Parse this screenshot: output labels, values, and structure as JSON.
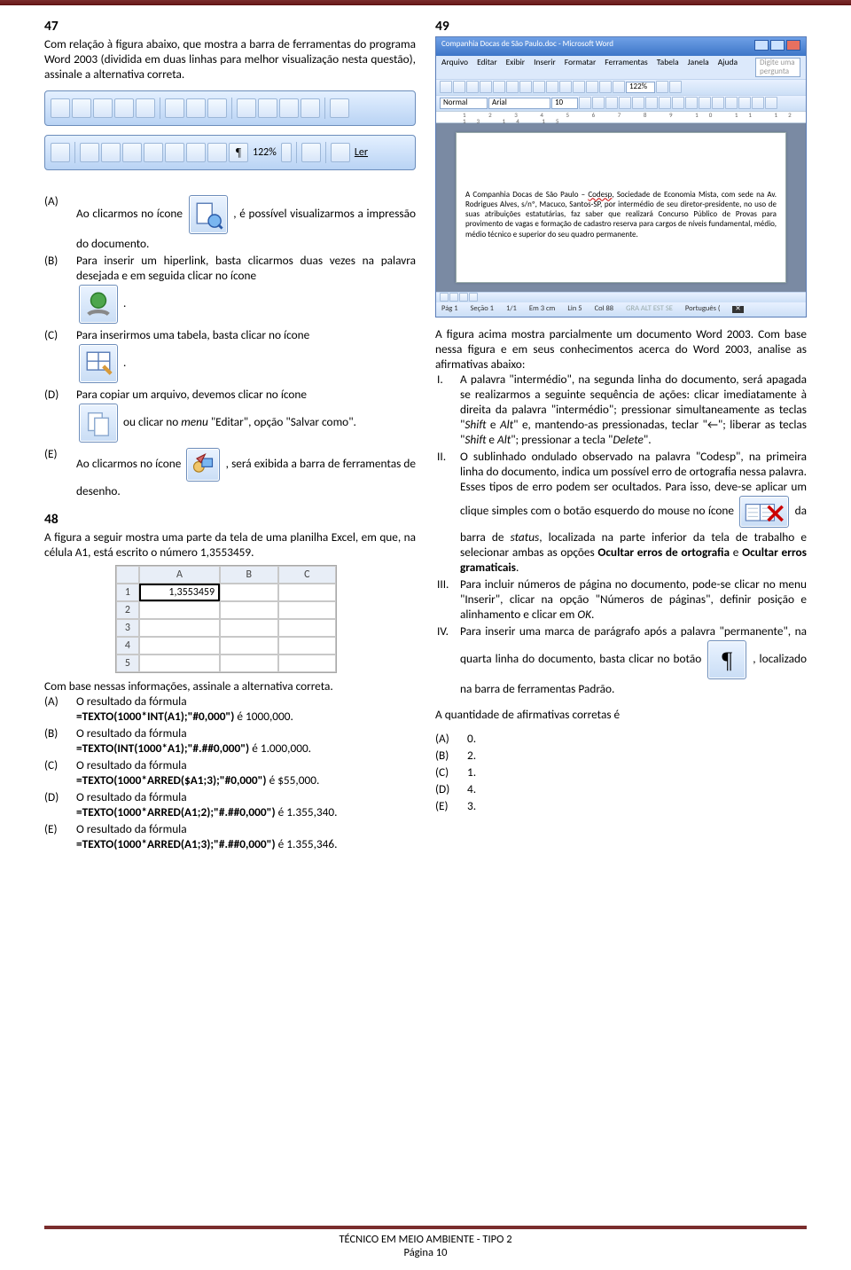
{
  "q47": {
    "number": "47",
    "stem": "Com relação à figura abaixo, que mostra a barra de ferramentas do programa Word 2003 (dividida em duas linhas para melhor visualização nesta questão), assinale a alternativa correta.",
    "toolbar2_zoom": "122%",
    "toolbar2_ler": "Ler",
    "options": {
      "A": {
        "pre": "Ao clicarmos no ícone ",
        "post": ", é possível visualizarmos a impressão do documento."
      },
      "B": {
        "pre": "Para inserir um hiperlink, basta clicarmos duas vezes na palavra desejada e em seguida clicar no ícone ",
        "post": "."
      },
      "C": {
        "pre": "Para inserirmos uma tabela, basta clicar no ícone ",
        "post": "."
      },
      "D": {
        "pre": "Para copiar um arquivo, devemos clicar no ícone ",
        "mid": " ou clicar no ",
        "menu": "menu",
        "mid2": " \"Editar\", opção \"Salvar como\"."
      },
      "E": {
        "pre": "Ao clicarmos no ícone ",
        "post": ", será exibida a barra de ferramentas de desenho."
      }
    }
  },
  "q48": {
    "number": "48",
    "stem": "A figura a seguir mostra uma parte da tela de uma planilha Excel, em que, na célula A1, está escrito o número 1,3553459.",
    "excel": {
      "headers": [
        "",
        "A",
        "B",
        "C"
      ],
      "a1": "1,3553459",
      "rows": [
        "1",
        "2",
        "3",
        "4",
        "5"
      ]
    },
    "lead": "Com base nessas informações, assinale a alternativa correta.",
    "options": {
      "A": {
        "t1": "O resultado da fórmula",
        "f": "=TEXTO(1000*INT(A1);\"#0,000\")",
        "r": " é 1000,000."
      },
      "B": {
        "t1": "O resultado da fórmula",
        "f": "=TEXTO(INT(1000*A1);\"#.##0,000\")",
        "r": " é 1.000,000."
      },
      "C": {
        "t1": "O resultado da fórmula",
        "f": "=TEXTO(1000*ARRED($A1;3);\"#0,000\")",
        "r": " é $55,000."
      },
      "D": {
        "t1": "O resultado da fórmula",
        "f": "=TEXTO(1000*ARRED(A1;2);\"#.##0,000\")",
        "r": " é 1.355,340."
      },
      "E": {
        "t1": "O resultado da fórmula",
        "f": "=TEXTO(1000*ARRED(A1;3);\"#.##0,000\")",
        "r": " é 1.355,346."
      }
    }
  },
  "q49": {
    "number": "49",
    "word": {
      "title": "Companhia Docas de São Paulo.doc - Microsoft Word",
      "menu": [
        "Arquivo",
        "Editar",
        "Exibir",
        "Inserir",
        "Formatar",
        "Ferramentas",
        "Tabela",
        "Janela",
        "Ajuda"
      ],
      "help": "Digite uma pergunta",
      "style": "Normal",
      "font": "Arial",
      "size": "10",
      "zoom": "122%",
      "ruler": "1 2 3 4 5 6 7 8 9 10 11 12 13 14 15",
      "doc": "A Companhia Docas de São Paulo – Codesp, Sociedade de Economia Mista, com sede na Av. Rodrigues Alves, s/nº, Macuco, Santos-SP, por intermédio de seu diretor-presidente, no uso de suas atribuições estatutárias, faz saber que realizará Concurso Público de Provas para provimento de vagas e formação de cadastro reserva para cargos de níveis fundamental, médio, médio técnico e superior do seu quadro permanente.",
      "codesp": "Codesp",
      "status": {
        "pag": "Pág 1",
        "sec": "Seção 1",
        "pp": "1/1",
        "em": "Em 3 cm",
        "lin": "Lin 5",
        "col": "Col 88",
        "mode": "GRA ALT EST SE",
        "lang": "Português ("
      }
    },
    "intro": "A figura acima mostra parcialmente um documento Word 2003. Com base nessa figura e em seus conhecimentos acerca do Word 2003, analise as afirmativas abaixo:",
    "I_a": "A palavra \"intermédio\", na segunda linha do documento, será apagada se realizarmos a seguinte sequência de ações: clicar imediatamente à direita da palavra \"intermédio\"; pressionar simultaneamente as teclas \"",
    "I_shift": "Shift",
    "I_b": " e ",
    "I_alt": "Alt",
    "I_c": "\" e, mantendo-as pressionadas, teclar \"←\"; liberar as teclas \"",
    "I_shift2": "Shift",
    "I_d": " e ",
    "I_alt2": "Alt",
    "I_e": "\"; pressionar a tecla \"",
    "I_del": "Delete",
    "I_f": "\".",
    "II_a": "O sublinhado ondulado observado na palavra \"Codesp\", na primeira linha do documento, indica um possível erro de ortografia nessa palavra. Esses tipos de erro podem ser ocultados. Para isso, deve-se aplicar um clique simples com o botão esquerdo do mouse no ícone ",
    "II_b": " da barra de ",
    "II_status": "status",
    "II_c": ", localizada na parte inferior da tela de trabalho e selecionar ambas as opções ",
    "II_opt1": "Ocultar erros de ortografia",
    "II_d": " e ",
    "II_opt2": "Ocultar erros gramaticais",
    "II_e": ".",
    "III_a": "Para incluir números de página no documento, pode-se clicar no menu \"Inserir\", clicar na opção \"Números de páginas\", definir posição e alinhamento e clicar em ",
    "III_ok": "OK",
    "III_b": ".",
    "IV_a": "Para inserir uma marca de parágrafo após a palavra \"permanente\", na quarta linha do documento, basta clicar no botão ",
    "IV_b": ", localizado na barra de ferramentas Padrão.",
    "ask": "A quantidade de afirmativas corretas é",
    "ans": {
      "A": "0.",
      "B": "2.",
      "C": "1.",
      "D": "4.",
      "E": "3."
    }
  },
  "labels": {
    "A": "(A)",
    "B": "(B)",
    "C": "(C)",
    "D": "(D)",
    "E": "(E)"
  },
  "roman": {
    "I": "I.",
    "II": "II.",
    "III": "III.",
    "IV": "IV."
  },
  "footer": {
    "l1": "TÉCNICO EM MEIO AMBIENTE - TIPO 2",
    "l2": "Página 10"
  }
}
